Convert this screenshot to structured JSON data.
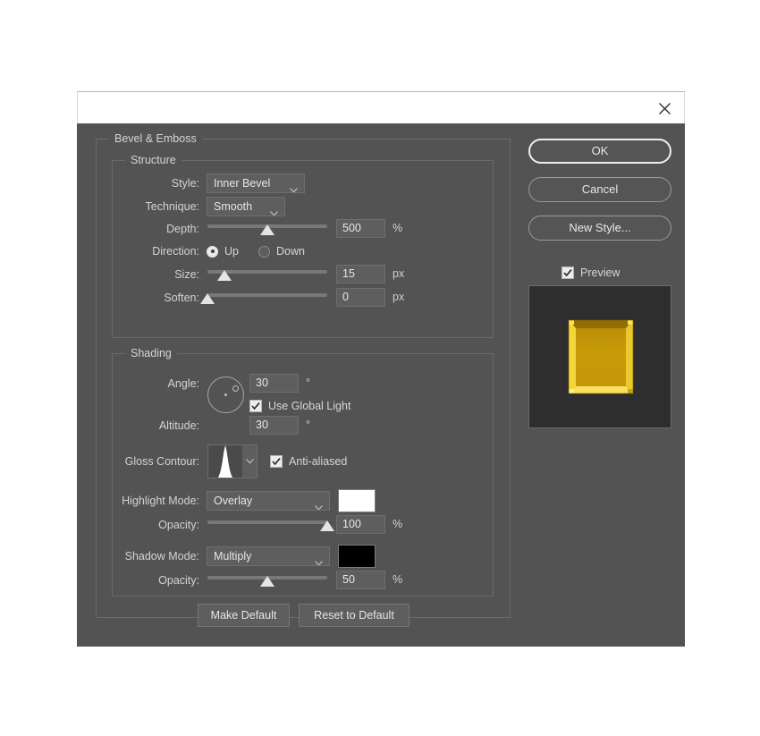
{
  "window": {
    "close_icon": "close-icon"
  },
  "groups": {
    "bevel_emboss": "Bevel & Emboss",
    "structure": "Structure",
    "shading": "Shading"
  },
  "structure": {
    "style": {
      "label": "Style:",
      "value": "Inner Bevel"
    },
    "technique": {
      "label": "Technique:",
      "value": "Smooth"
    },
    "depth": {
      "label": "Depth:",
      "value": "500",
      "unit": "%",
      "slider_pct": 50
    },
    "direction": {
      "label": "Direction:",
      "options": [
        {
          "label": "Up",
          "checked": true
        },
        {
          "label": "Down",
          "checked": false
        }
      ]
    },
    "size": {
      "label": "Size:",
      "value": "15",
      "unit": "px",
      "slider_pct": 14
    },
    "soften": {
      "label": "Soften:",
      "value": "0",
      "unit": "px",
      "slider_pct": 0
    }
  },
  "shading": {
    "angle": {
      "label": "Angle:",
      "value": "30",
      "unit": "°"
    },
    "use_global_light": {
      "label": "Use Global Light",
      "checked": true
    },
    "altitude": {
      "label": "Altitude:",
      "value": "30",
      "unit": "°"
    },
    "gloss_contour": {
      "label": "Gloss Contour:"
    },
    "anti_aliased": {
      "label": "Anti-aliased",
      "checked": true
    },
    "highlight_mode": {
      "label": "Highlight Mode:",
      "value": "Overlay",
      "color": "#ffffff"
    },
    "highlight_opacity": {
      "label": "Opacity:",
      "value": "100",
      "unit": "%",
      "slider_pct": 100
    },
    "shadow_mode": {
      "label": "Shadow Mode:",
      "value": "Multiply",
      "color": "#000000"
    },
    "shadow_opacity": {
      "label": "Opacity:",
      "value": "50",
      "unit": "%",
      "slider_pct": 50
    }
  },
  "footer": {
    "make_default": "Make Default",
    "reset_to_default": "Reset to Default"
  },
  "sidebar": {
    "ok": "OK",
    "cancel": "Cancel",
    "new_style": "New Style...",
    "preview": {
      "label": "Preview",
      "checked": true
    },
    "preview_swatch": {
      "background": "#2e2e2e",
      "fill": "#c39209",
      "highlight": "#ffe14d",
      "shadow": "#6e5204"
    }
  }
}
